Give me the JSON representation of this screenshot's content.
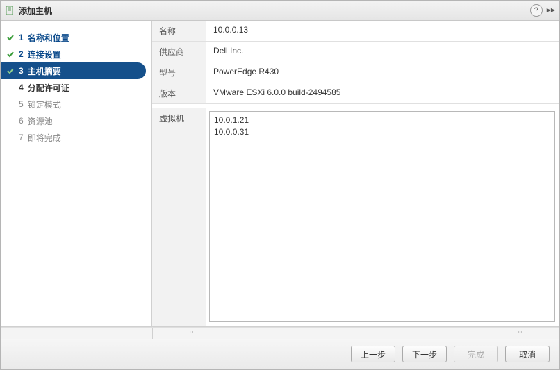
{
  "title": "添加主机",
  "steps": [
    {
      "num": "1",
      "label": "名称和位置",
      "state": "done"
    },
    {
      "num": "2",
      "label": "连接设置",
      "state": "done"
    },
    {
      "num": "3",
      "label": "主机摘要",
      "state": "active"
    },
    {
      "num": "4",
      "label": "分配许可证",
      "state": "pending"
    },
    {
      "num": "5",
      "label": "锁定模式",
      "state": "unvisited"
    },
    {
      "num": "6",
      "label": "资源池",
      "state": "unvisited"
    },
    {
      "num": "7",
      "label": "即将完成",
      "state": "unvisited"
    }
  ],
  "summary": {
    "name_label": "名称",
    "name_value": "10.0.0.13",
    "vendor_label": "供应商",
    "vendor_value": "Dell Inc.",
    "model_label": "型号",
    "model_value": "PowerEdge R430",
    "version_label": "版本",
    "version_value": "VMware ESXi 6.0.0 build-2494585",
    "vm_label": "虚拟机",
    "vms": [
      "10.0.1.21",
      "10.0.0.31"
    ]
  },
  "buttons": {
    "back": "上一步",
    "next": "下一步",
    "finish": "完成",
    "cancel": "取消"
  }
}
